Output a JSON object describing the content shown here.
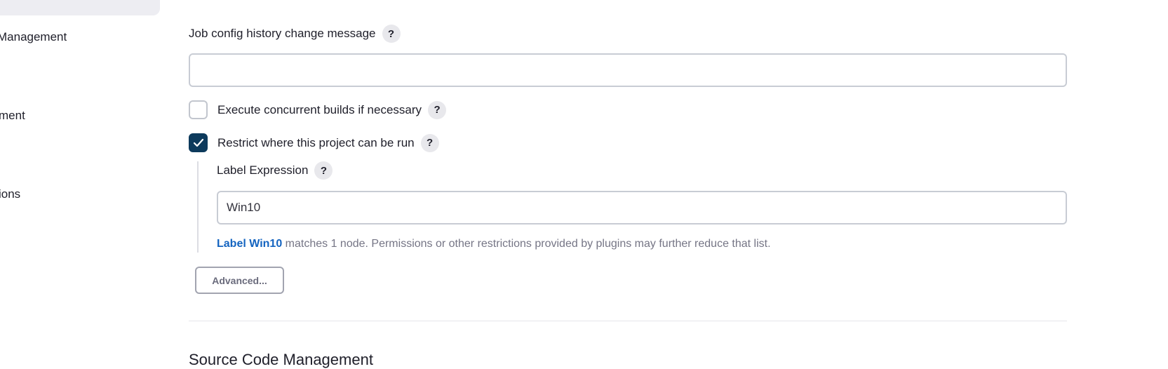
{
  "sidebar": {
    "items": [
      {
        "label": "Management"
      },
      {
        "label": "ment"
      },
      {
        "label": "ions"
      }
    ]
  },
  "config": {
    "change_message": {
      "label": "Job config history change message",
      "value": "",
      "placeholder": ""
    },
    "concurrent_builds": {
      "label": "Execute concurrent builds if necessary",
      "checked": false
    },
    "restrict_run": {
      "label": "Restrict where this project can be run",
      "checked": true,
      "label_expression": {
        "label": "Label Expression",
        "value": "Win10"
      },
      "match_info": {
        "link_text": "Label Win10",
        "text": " matches 1 node. Permissions or other restrictions provided by plugins may further reduce that list."
      }
    },
    "advanced_label": "Advanced..."
  },
  "sections": {
    "source_code_management": "Source Code Management"
  },
  "icons": {
    "help": "help-icon",
    "check": "check-icon"
  },
  "colors": {
    "checkbox_checked": "#0d3a5c",
    "link": "#1464c0"
  }
}
